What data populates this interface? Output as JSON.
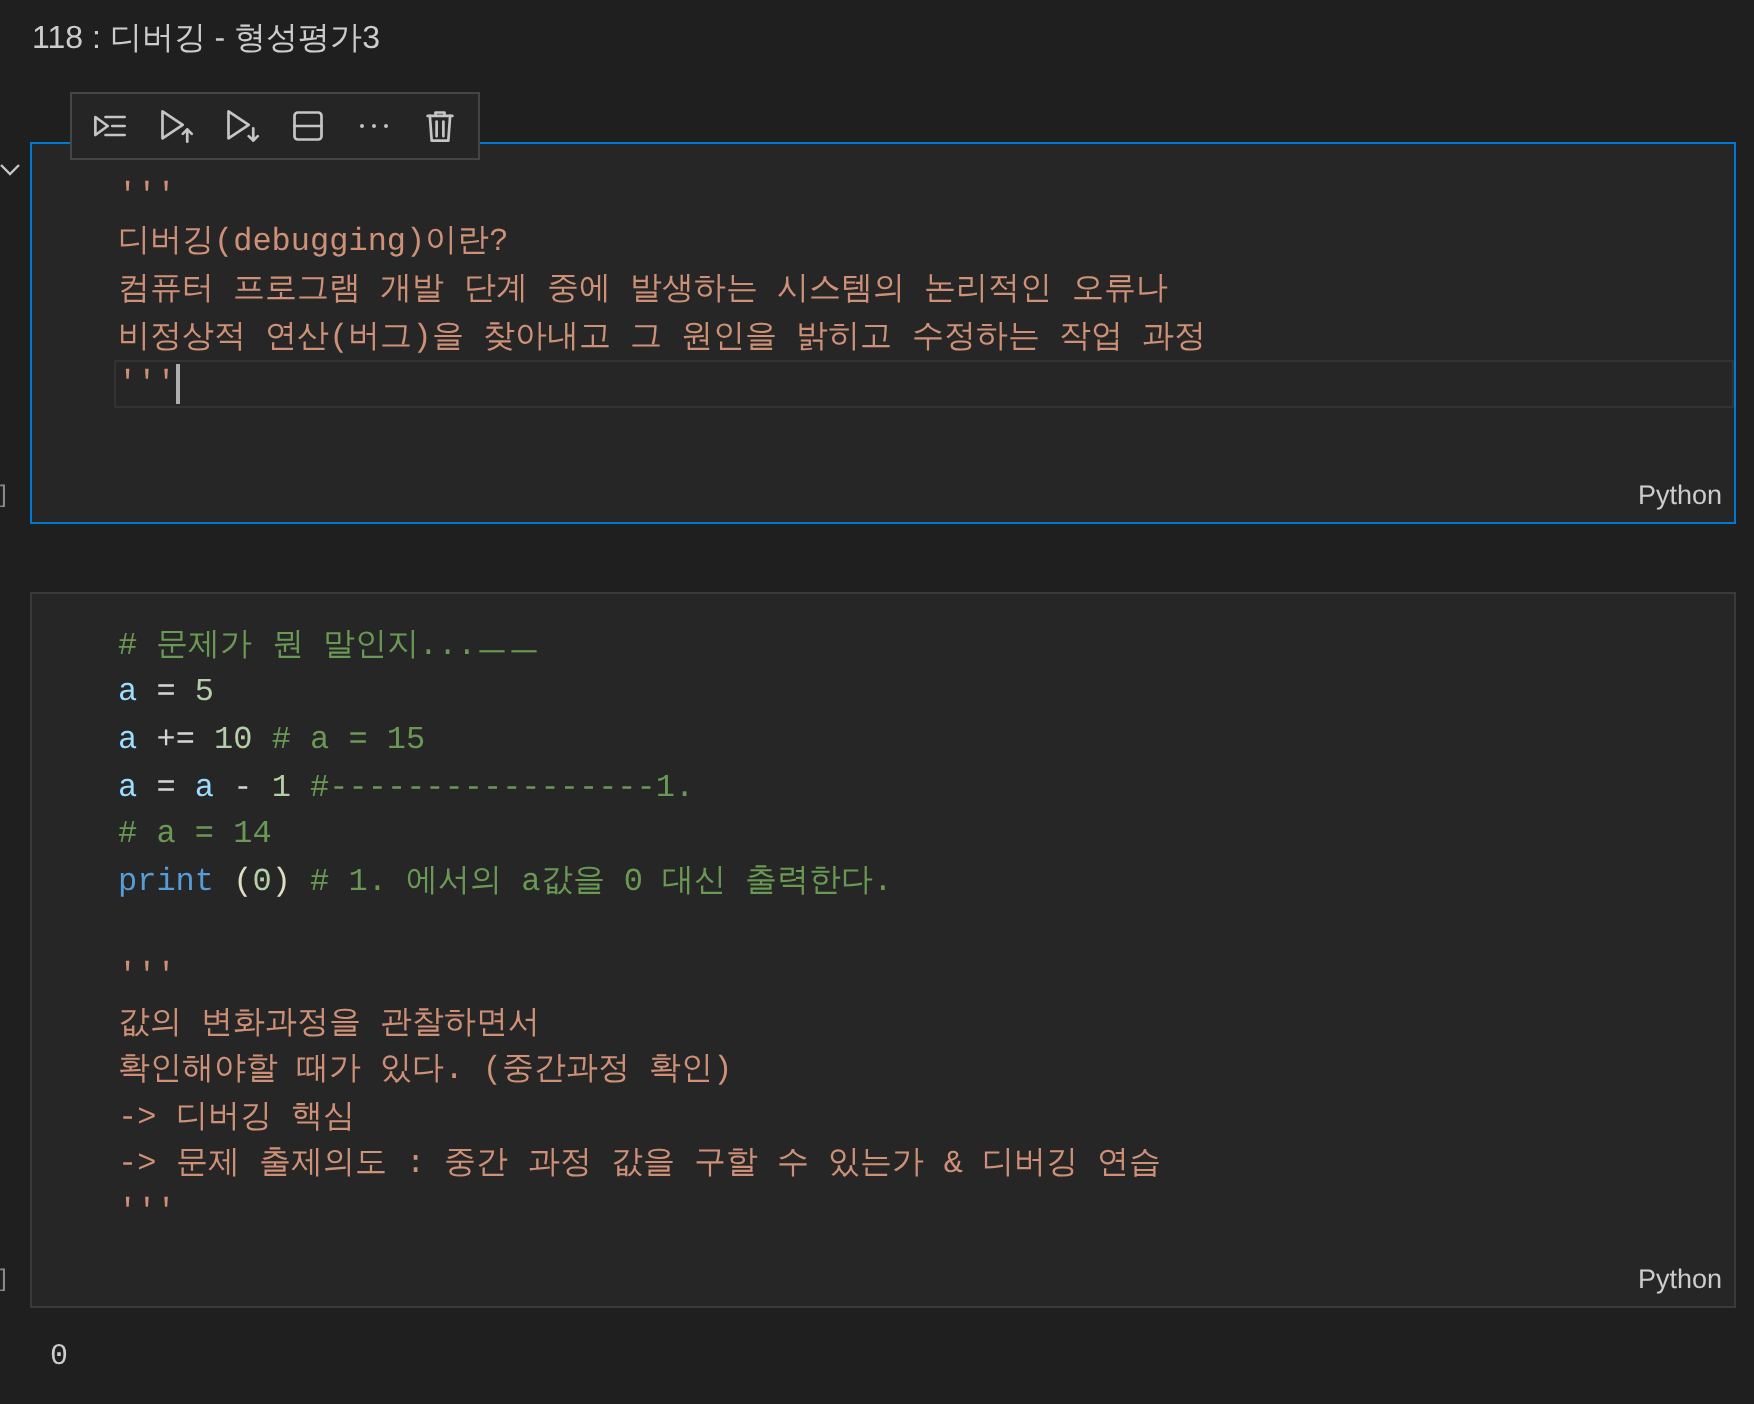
{
  "notebook": {
    "title": "118 : 디버깅 - 형성평가3"
  },
  "cells": [
    {
      "selected": true,
      "execution_count": "]",
      "language": "Python",
      "lines": [
        {
          "kind": "code",
          "cursor": false,
          "tokens": [
            {
              "text": "'''",
              "kind": "string"
            }
          ]
        },
        {
          "kind": "code",
          "cursor": false,
          "tokens": [
            {
              "text": "디버깅(debugging)이란?",
              "kind": "string"
            }
          ]
        },
        {
          "kind": "code",
          "cursor": false,
          "tokens": [
            {
              "text": "컴퓨터 프로그램 개발 단계 중에 발생하는 시스템의 논리적인 오류나",
              "kind": "string"
            }
          ]
        },
        {
          "kind": "code",
          "cursor": false,
          "tokens": [
            {
              "text": "비정상적 연산(버그)을 찾아내고 그 원인을 밝히고 수정하는 작업 과정",
              "kind": "string"
            }
          ]
        },
        {
          "kind": "code",
          "cursor": true,
          "tokens": [
            {
              "text": "'''",
              "kind": "string"
            }
          ]
        }
      ]
    },
    {
      "selected": false,
      "execution_count": "]",
      "language": "Python",
      "output": "0",
      "lines": [
        {
          "kind": "code",
          "cursor": false,
          "tokens": [
            {
              "text": "# 문제가 뭔 말인지...ㅡㅡ",
              "kind": "comment"
            }
          ]
        },
        {
          "kind": "code",
          "cursor": false,
          "tokens": [
            {
              "text": "a",
              "kind": "variable"
            },
            {
              "text": " = ",
              "kind": "operator"
            },
            {
              "text": "5",
              "kind": "number"
            }
          ]
        },
        {
          "kind": "code",
          "cursor": false,
          "tokens": [
            {
              "text": "a",
              "kind": "variable"
            },
            {
              "text": " += ",
              "kind": "operator"
            },
            {
              "text": "10",
              "kind": "number"
            },
            {
              "text": " # a = 15",
              "kind": "comment"
            }
          ]
        },
        {
          "kind": "code",
          "cursor": false,
          "tokens": [
            {
              "text": "a",
              "kind": "variable"
            },
            {
              "text": " = ",
              "kind": "operator"
            },
            {
              "text": "a",
              "kind": "variable"
            },
            {
              "text": " - ",
              "kind": "operator"
            },
            {
              "text": "1",
              "kind": "number"
            },
            {
              "text": " #-----------------1.",
              "kind": "comment"
            }
          ]
        },
        {
          "kind": "code",
          "cursor": false,
          "tokens": [
            {
              "text": "# a = 14",
              "kind": "comment"
            }
          ]
        },
        {
          "kind": "code",
          "cursor": false,
          "tokens": [
            {
              "text": "print",
              "kind": "function"
            },
            {
              "text": " (",
              "kind": "bracket"
            },
            {
              "text": "0",
              "kind": "number"
            },
            {
              "text": ")",
              "kind": "bracket"
            },
            {
              "text": " # 1. 에서의 a값을 0 대신 출력한다.",
              "kind": "comment"
            }
          ]
        },
        {
          "kind": "blank",
          "cursor": false
        },
        {
          "kind": "code",
          "cursor": false,
          "tokens": [
            {
              "text": "'''",
              "kind": "string"
            }
          ]
        },
        {
          "kind": "code",
          "cursor": false,
          "tokens": [
            {
              "text": "값의 변화과정을 관찰하면서",
              "kind": "string"
            }
          ]
        },
        {
          "kind": "code",
          "cursor": false,
          "tokens": [
            {
              "text": "확인해야할 때가 있다. (중간과정 확인)",
              "kind": "string"
            }
          ]
        },
        {
          "kind": "code",
          "cursor": false,
          "tokens": [
            {
              "text": "-> 디버깅 핵심",
              "kind": "string"
            }
          ]
        },
        {
          "kind": "code",
          "cursor": false,
          "tokens": [
            {
              "text": "-> 문제 출제의도 : 중간 과정 값을 구할 수 있는가 & 디버깅 연습",
              "kind": "string"
            }
          ]
        },
        {
          "kind": "code",
          "cursor": false,
          "tokens": [
            {
              "text": "'''",
              "kind": "string"
            }
          ]
        }
      ]
    }
  ]
}
